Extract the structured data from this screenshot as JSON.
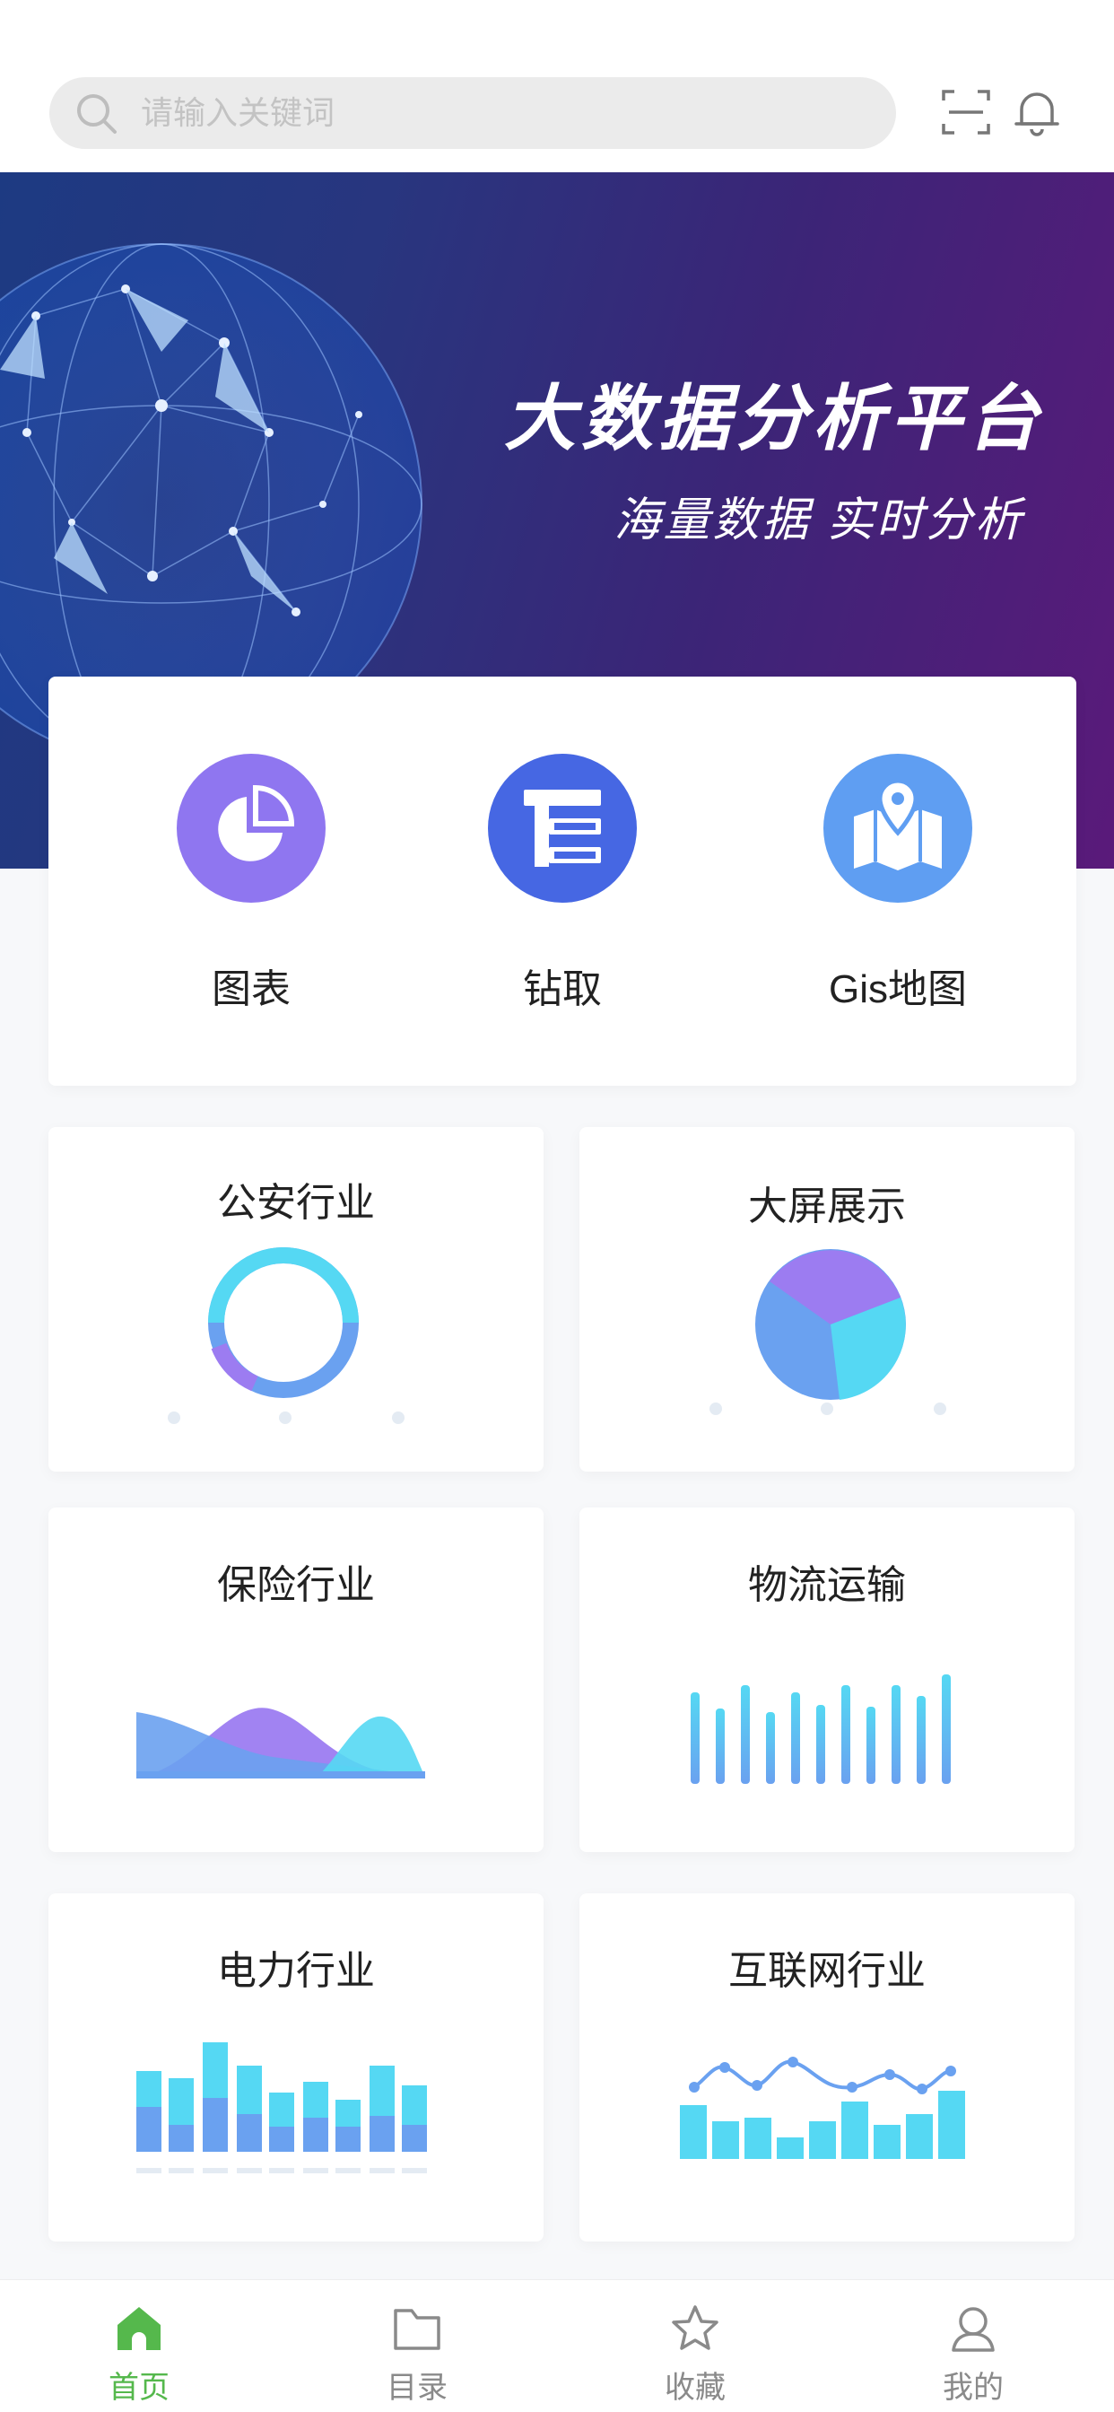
{
  "search": {
    "placeholder": "请输入关键词"
  },
  "header": {
    "scan_icon": "scan-icon",
    "bell_icon": "bell-icon"
  },
  "banner": {
    "title": "大数据分析平台",
    "subtitle": "海量数据  实时分析"
  },
  "quick_actions": [
    {
      "label": "图表",
      "icon": "pie-chart-icon",
      "color": "#8f76f0"
    },
    {
      "label": "钻取",
      "icon": "drill-icon",
      "color": "#4667e3"
    },
    {
      "label": "Gis地图",
      "icon": "map-pin-icon",
      "color": "#5f9ef2"
    }
  ],
  "industry_cards": [
    {
      "title": "公安行业",
      "icon": "donut-chart-icon"
    },
    {
      "title": "大屏展示",
      "icon": "pie-chart-icon"
    },
    {
      "title": "保险行业",
      "icon": "area-chart-icon"
    },
    {
      "title": "物流运输",
      "icon": "bar-chart-icon"
    },
    {
      "title": "电力行业",
      "icon": "stacked-bar-icon"
    },
    {
      "title": "互联网行业",
      "icon": "bar-line-chart-icon"
    }
  ],
  "tabbar": [
    {
      "label": "首页",
      "icon": "home-icon",
      "active": true
    },
    {
      "label": "目录",
      "icon": "folder-icon",
      "active": false
    },
    {
      "label": "收藏",
      "icon": "star-icon",
      "active": false
    },
    {
      "label": "我的",
      "icon": "user-icon",
      "active": false
    }
  ],
  "colors": {
    "accent": "#55b84c",
    "cyan": "#55d8f3",
    "blue": "#6aa1f0",
    "purple": "#9c7cf1"
  }
}
